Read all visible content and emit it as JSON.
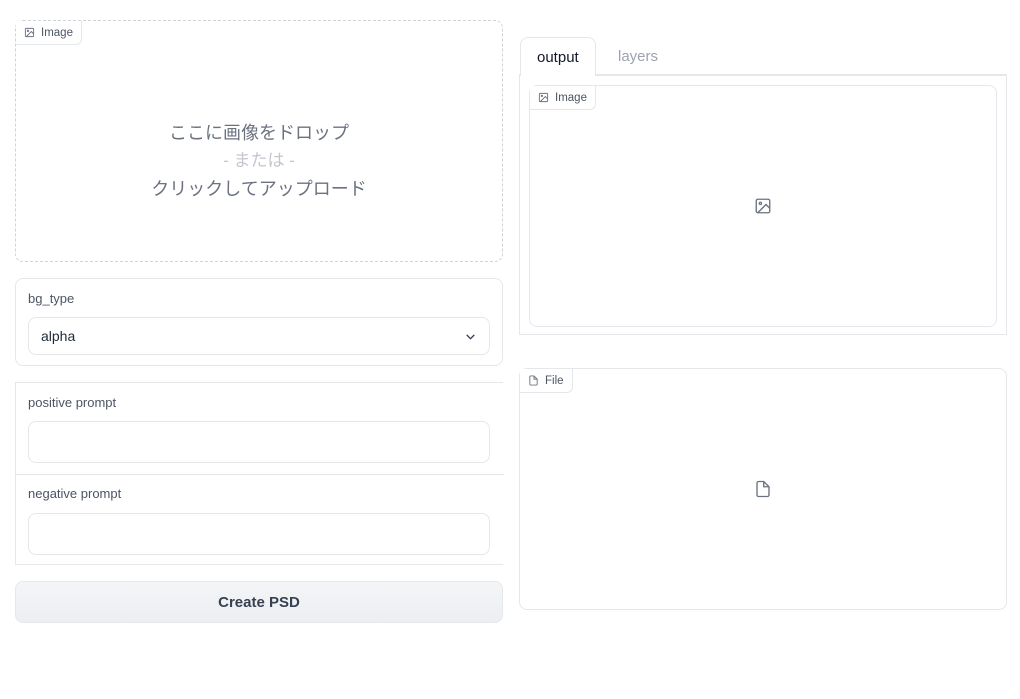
{
  "upload": {
    "label": "Image",
    "line1": "ここに画像をドロップ",
    "line2": "- または -",
    "line3": "クリックしてアップロード"
  },
  "bg_type": {
    "label": "bg_type",
    "value": "alpha"
  },
  "prompts": {
    "positive_label": "positive prompt",
    "positive_value": "",
    "negative_label": "negative prompt",
    "negative_value": ""
  },
  "create_button": "Create PSD",
  "tabs": [
    {
      "label": "output",
      "active": true
    },
    {
      "label": "layers",
      "active": false
    }
  ],
  "output_image": {
    "label": "Image"
  },
  "file": {
    "label": "File"
  },
  "icons": {
    "image": "image-icon",
    "file": "file-icon",
    "chevron": "chevron-down-icon"
  }
}
